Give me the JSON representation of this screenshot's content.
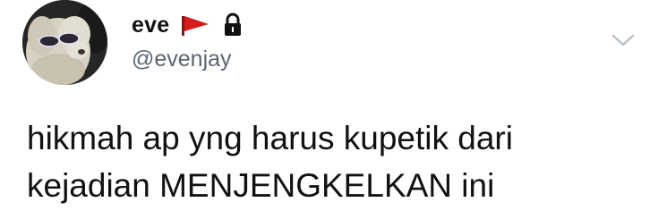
{
  "user": {
    "display_name": "eve",
    "handle": "@evenjay",
    "avatar_icon": "dog-with-sunglasses-avatar",
    "flag_icon": "red-flag-icon",
    "flag_color": "#d81b1b",
    "protected_icon": "lock-icon"
  },
  "menu": {
    "chevron_icon": "chevron-down-icon",
    "chevron_color": "#b9c1c9"
  },
  "tweet": {
    "lines": [
      "hikmah ap yng harus kupetik dari",
      "kejadian MENJENGKELKAN ini"
    ]
  }
}
